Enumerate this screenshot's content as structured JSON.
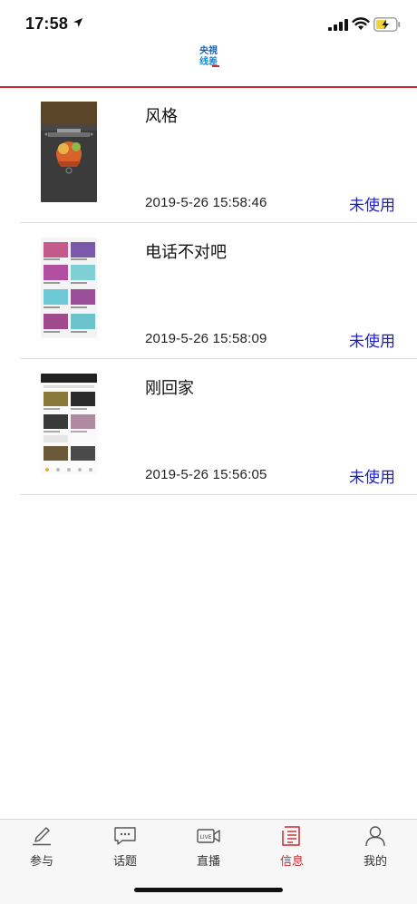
{
  "status_bar": {
    "time": "17:58"
  },
  "header": {
    "logo_line1": "央視",
    "logo_line2": "线差"
  },
  "items": [
    {
      "title": "风格",
      "date": "2019-5-26 15:58:46",
      "status": "未使用"
    },
    {
      "title": "电话不对吧",
      "date": "2019-5-26 15:58:09",
      "status": "未使用"
    },
    {
      "title": "刚回家",
      "date": "2019-5-26 15:56:05",
      "status": "未使用"
    }
  ],
  "tabs": [
    {
      "label": "参与",
      "icon": "pencil-icon"
    },
    {
      "label": "话题",
      "icon": "chat-bubble-icon"
    },
    {
      "label": "直播",
      "icon": "live-camera-icon"
    },
    {
      "label": "信息",
      "icon": "document-icon",
      "active": true
    },
    {
      "label": "我的",
      "icon": "person-icon"
    }
  ],
  "colors": {
    "accent": "#d0262e",
    "status_link": "#1c1fc4"
  }
}
